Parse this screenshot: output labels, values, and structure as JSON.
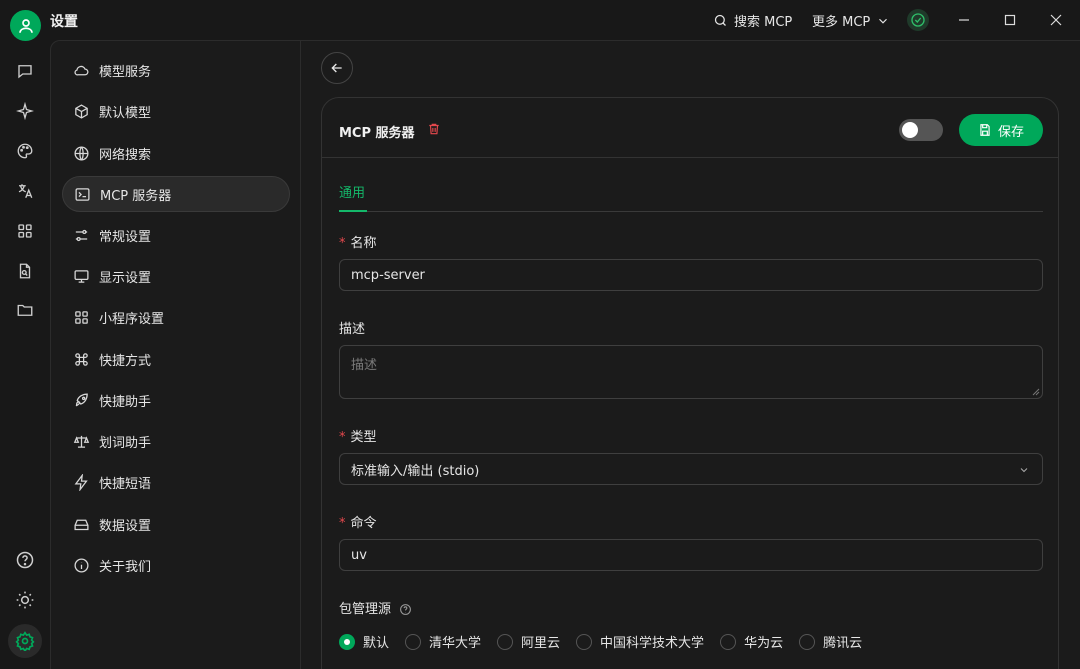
{
  "app": {
    "title": "设置"
  },
  "titlebar": {
    "search_mcp": "搜索 MCP",
    "more_mcp": "更多 MCP"
  },
  "rail": {
    "icons": [
      "chat-icon",
      "sparkle-icon",
      "palette-icon",
      "translate-icon",
      "apps-icon",
      "file-search-icon",
      "folder-icon",
      "help-icon",
      "theme-icon",
      "settings-icon"
    ]
  },
  "sidebar": {
    "items": [
      {
        "label": "模型服务",
        "icon": "cloud-icon"
      },
      {
        "label": "默认模型",
        "icon": "cube-icon"
      },
      {
        "label": "网络搜索",
        "icon": "globe-icon"
      },
      {
        "label": "MCP 服务器",
        "icon": "terminal-icon"
      },
      {
        "label": "常规设置",
        "icon": "sliders-icon"
      },
      {
        "label": "显示设置",
        "icon": "monitor-icon"
      },
      {
        "label": "小程序设置",
        "icon": "grid-icon"
      },
      {
        "label": "快捷方式",
        "icon": "command-icon"
      },
      {
        "label": "快捷助手",
        "icon": "rocket-icon"
      },
      {
        "label": "划词助手",
        "icon": "scale-icon"
      },
      {
        "label": "快捷短语",
        "icon": "zap-icon"
      },
      {
        "label": "数据设置",
        "icon": "hard-drive-icon"
      },
      {
        "label": "关于我们",
        "icon": "info-icon"
      }
    ],
    "active_index": 3
  },
  "card": {
    "title": "MCP 服务器",
    "save_label": "保存",
    "enabled": false,
    "tab": "通用"
  },
  "form": {
    "name": {
      "label": "名称",
      "required": "*",
      "value": "mcp-server"
    },
    "description": {
      "label": "描述",
      "placeholder": "描述"
    },
    "type": {
      "label": "类型",
      "required": "*",
      "value": "标准输入/输出 (stdio)"
    },
    "command": {
      "label": "命令",
      "required": "*",
      "value": "uv"
    },
    "registry": {
      "label": "包管理源",
      "options": [
        "默认",
        "清华大学",
        "阿里云",
        "中国科学技术大学",
        "华为云",
        "腾讯云"
      ],
      "selected": "默认"
    }
  },
  "colors": {
    "accent": "#00a85a",
    "danger": "#e5484d",
    "background": "#181818"
  }
}
